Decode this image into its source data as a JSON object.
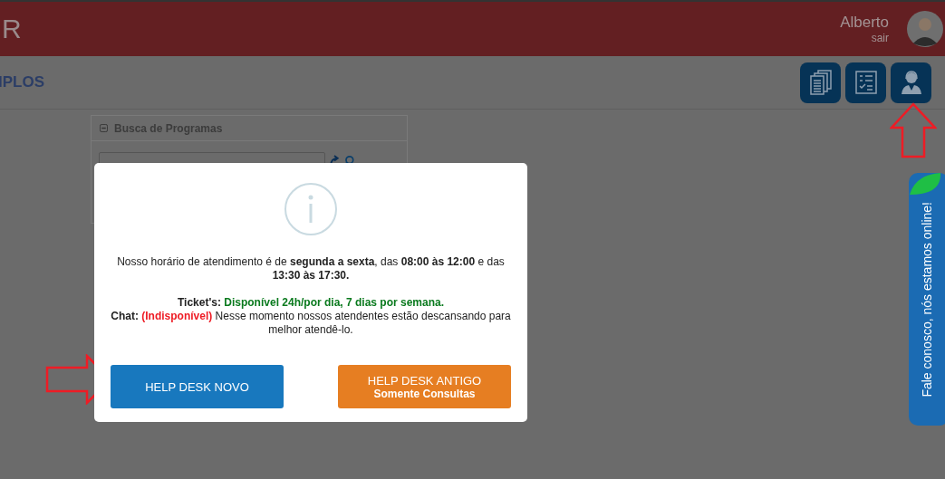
{
  "header": {
    "logo": "R",
    "user": {
      "name": "Alberto",
      "logout": "sair"
    }
  },
  "page": {
    "title": "IPLOS",
    "toolbar": [
      {
        "kind": "documents"
      },
      {
        "kind": "checklist"
      },
      {
        "kind": "support"
      }
    ]
  },
  "panel": {
    "title": "Busca de Programas"
  },
  "modal": {
    "paragraphs": [
      {
        "segments": [
          {
            "text": "Nosso horário de atendimento é de ",
            "bold": false
          },
          {
            "text": "segunda a sexta",
            "bold": true
          },
          {
            "text": ", das ",
            "bold": false
          },
          {
            "text": "08:00 às 12:00",
            "bold": true
          },
          {
            "text": " e das ",
            "bold": false
          },
          {
            "text": "13:30 às 17:30.",
            "bold": true
          }
        ]
      },
      {
        "segments": [
          {
            "text": "Ticket's: ",
            "bold": true
          },
          {
            "text": "Disponível 24h/por dia, 7 dias por semana.",
            "bold": true,
            "color": "#0a7a1e"
          }
        ]
      },
      {
        "segments": [
          {
            "text": "Chat: ",
            "bold": true
          },
          {
            "text": "(Indisponível)",
            "bold": true,
            "color": "#ee1c25"
          },
          {
            "text": " Nesse momento nossos atendentes estão descansando para melhor atendê-lo.",
            "bold": false
          }
        ]
      }
    ],
    "buttons": [
      {
        "label": "HELP DESK NOVO",
        "kind": "primary"
      },
      {
        "label": "HELP DESK ANTIGO",
        "sublabel": "Somente Consultas",
        "kind": "warning"
      }
    ]
  },
  "chat_tab": {
    "label": "Fale conosco, nós estamos online!"
  }
}
